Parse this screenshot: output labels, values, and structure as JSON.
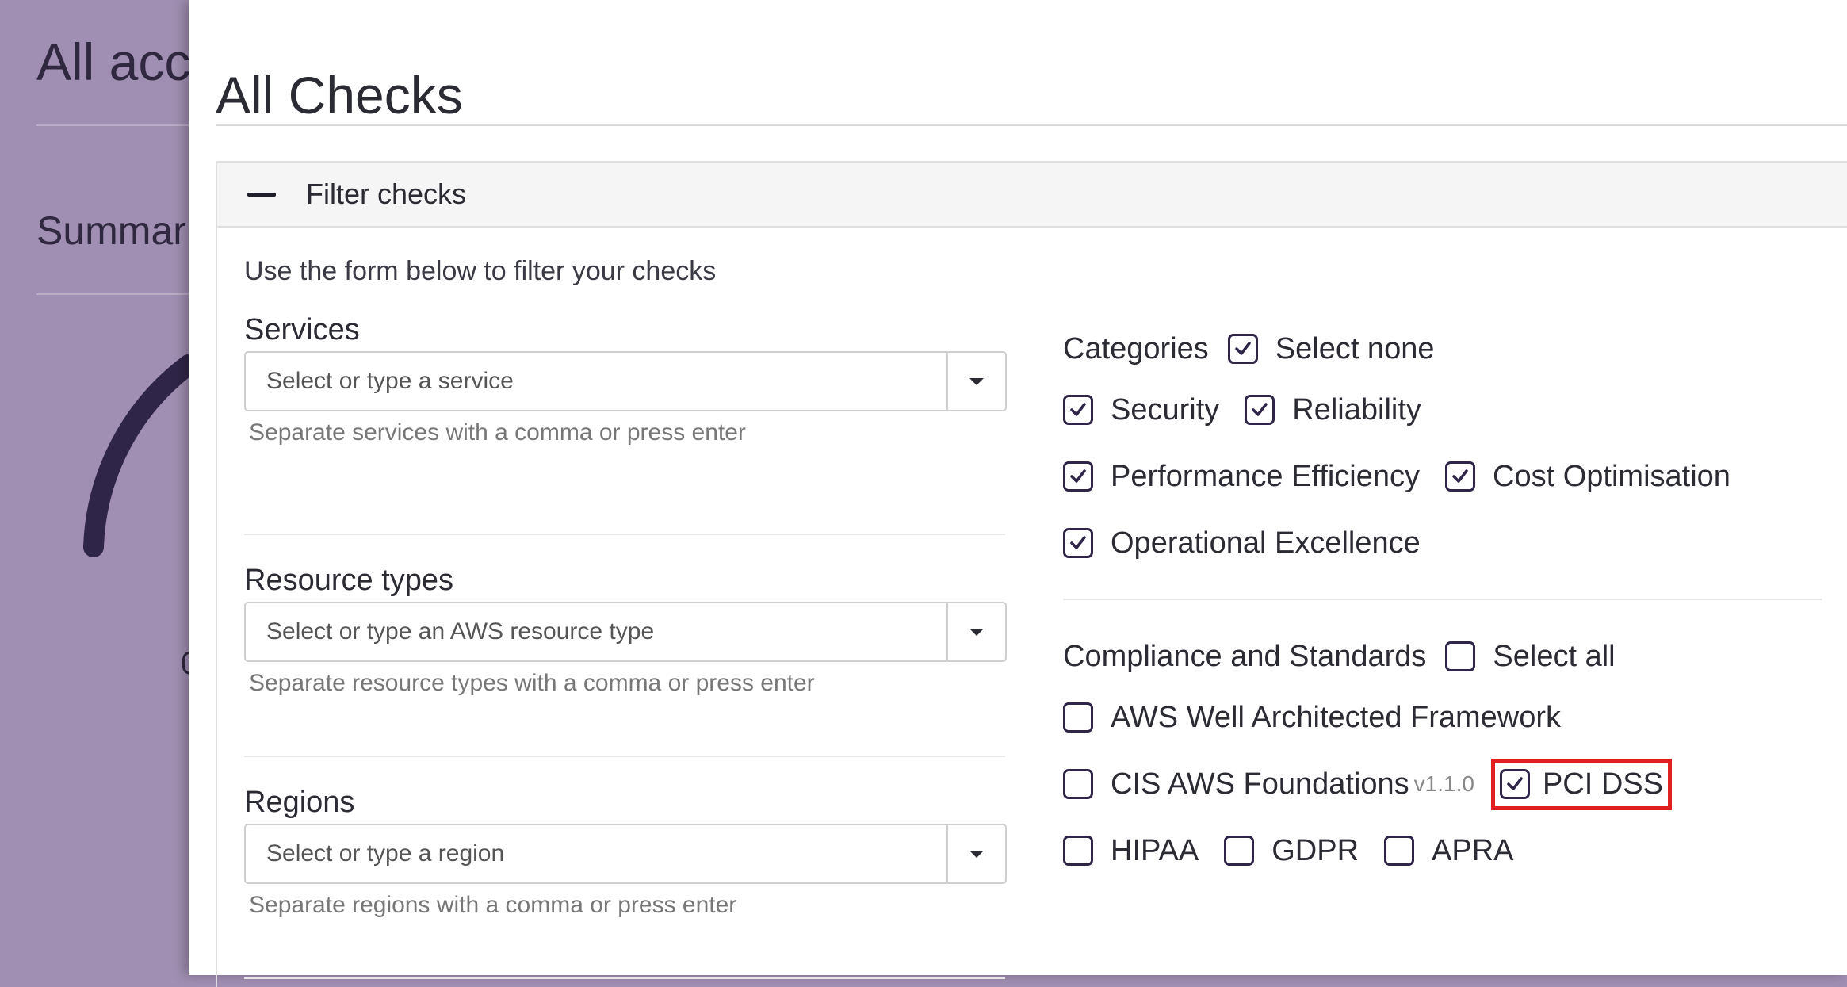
{
  "background": {
    "title": "All acc",
    "summary": "Summar",
    "gauge_value": "0"
  },
  "drawer": {
    "title": "All Checks",
    "filter_header": "Filter checks",
    "intro": "Use the form below to filter your checks",
    "fields": [
      {
        "label": "Services",
        "placeholder": "Select or type a service",
        "help": "Separate services with a comma or press enter"
      },
      {
        "label": "Resource types",
        "placeholder": "Select or type an AWS resource type",
        "help": "Separate resource types with a comma or press enter"
      },
      {
        "label": "Regions",
        "placeholder": "Select or type a region",
        "help": "Separate regions with a comma or press enter"
      }
    ],
    "categories": {
      "title": "Categories",
      "toggle_label": "Select none",
      "toggle_checked": true,
      "items": [
        {
          "label": "Security",
          "checked": true
        },
        {
          "label": "Reliability",
          "checked": true
        },
        {
          "label": "Performance Efficiency",
          "checked": true
        },
        {
          "label": "Cost Optimisation",
          "checked": true
        },
        {
          "label": "Operational Excellence",
          "checked": true
        }
      ]
    },
    "compliance": {
      "title": "Compliance and Standards",
      "toggle_label": "Select all",
      "toggle_checked": false,
      "items": [
        {
          "label": "AWS Well Architected Framework",
          "checked": false
        },
        {
          "label": "CIS AWS Foundations",
          "version": "v1.1.0",
          "checked": false
        },
        {
          "label": "PCI DSS",
          "checked": true
        },
        {
          "label": "HIPAA",
          "checked": false
        },
        {
          "label": "GDPR",
          "checked": false
        },
        {
          "label": "APRA",
          "checked": false
        }
      ]
    }
  },
  "colors": {
    "check_border": "#2f2548",
    "highlight": "#e02020",
    "overlay": "#a08fb2"
  }
}
